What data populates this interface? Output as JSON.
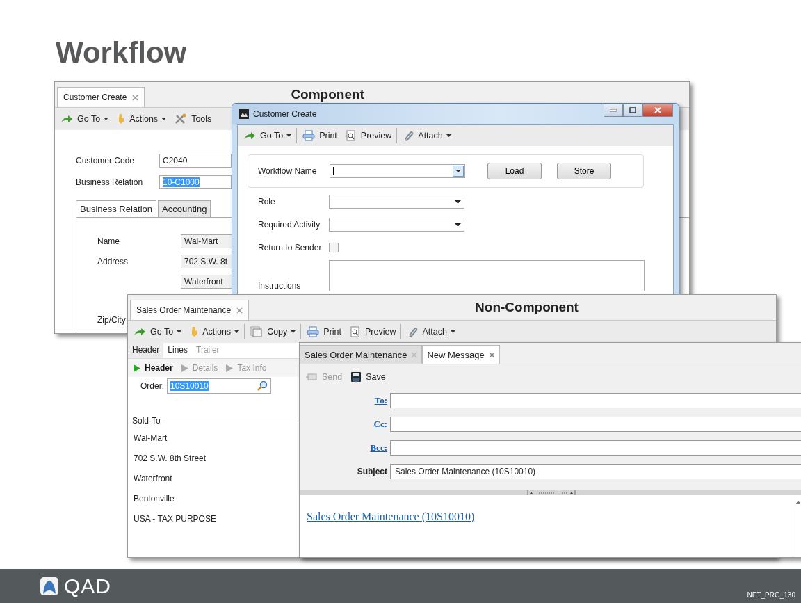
{
  "slide_title": "Workflow",
  "component_window": {
    "tabs": [
      {
        "label": "Customer Create",
        "selected": true
      }
    ],
    "caption": "Component",
    "toolbar": [
      {
        "kind": "goto",
        "label": "Go To",
        "dropdown": true,
        "separator_after": false,
        "disabled": false
      },
      {
        "kind": "actions",
        "label": "Actions",
        "dropdown": true,
        "separator_after": false,
        "disabled": false
      },
      {
        "kind": "tools",
        "label": "Tools",
        "dropdown": false,
        "separator_after": false,
        "disabled": false
      }
    ],
    "fields": [
      {
        "label": "Customer Code",
        "value": "C2040",
        "highlighted": false
      },
      {
        "label": "Business Relation",
        "value": "10-C1000",
        "highlighted": true
      }
    ],
    "section_tabs": [
      {
        "label": "Business Relation",
        "selected": true
      },
      {
        "label": "Accounting",
        "selected": false
      }
    ],
    "address_rows": [
      {
        "label": "Name",
        "value": "Wal-Mart"
      },
      {
        "label": "Address",
        "value": "702 S.W. 8t"
      },
      {
        "value": "Waterfront"
      }
    ],
    "zip_label": "Zip/City"
  },
  "dialog": {
    "title": "Customer Create",
    "toolbar": [
      {
        "kind": "goto",
        "label": "Go To",
        "dropdown": true,
        "separator_after": true,
        "disabled": false
      },
      {
        "kind": "print",
        "label": "Print",
        "dropdown": false,
        "separator_after": false,
        "disabled": false
      },
      {
        "kind": "preview",
        "label": "Preview",
        "dropdown": false,
        "separator_after": true,
        "disabled": false
      },
      {
        "kind": "attach",
        "label": "Attach",
        "dropdown": true,
        "separator_after": false,
        "disabled": false
      }
    ],
    "workflow_name_label": "Workflow Name",
    "buttons": [
      "Load",
      "Store"
    ],
    "dropdowns": [
      {
        "label": "Role"
      },
      {
        "label": "Required Activity"
      }
    ],
    "return_to_sender": {
      "label": "Return to Sender",
      "checked": false
    },
    "instructions_label": "Instructions"
  },
  "sales_window": {
    "tabs": [
      {
        "label": "Sales Order Maintenance",
        "selected": true
      }
    ],
    "caption": "Non-Component",
    "toolbar": [
      {
        "kind": "goto",
        "label": "Go To",
        "dropdown": true,
        "separator_after": false,
        "disabled": false
      },
      {
        "kind": "actions",
        "label": "Actions",
        "dropdown": true,
        "separator_after": true,
        "disabled": false
      },
      {
        "kind": "copy",
        "label": "Copy",
        "dropdown": true,
        "separator_after": true,
        "disabled": false
      },
      {
        "kind": "print",
        "label": "Print",
        "dropdown": false,
        "separator_after": false,
        "disabled": false
      },
      {
        "kind": "preview",
        "label": "Preview",
        "dropdown": false,
        "separator_after": true,
        "disabled": false
      },
      {
        "kind": "attach",
        "label": "Attach",
        "dropdown": true,
        "separator_after": false,
        "disabled": false
      }
    ],
    "section_tabs": [
      {
        "label": "Header",
        "selected": true,
        "disabled": false
      },
      {
        "label": "Lines",
        "selected": false,
        "disabled": false
      },
      {
        "label": "Trailer",
        "selected": false,
        "disabled": true
      }
    ],
    "steps": [
      {
        "label": "Header",
        "selected": true
      },
      {
        "label": "Details",
        "selected": false
      },
      {
        "label": "Tax Info",
        "selected": false
      }
    ],
    "order": {
      "label": "Order:",
      "value": "10S10010",
      "highlighted": true
    },
    "sold_to": {
      "heading": "Sold-To",
      "lines": [
        "Wal-Mart",
        "702 S.W. 8th Street",
        "Waterfront",
        "Bentonville",
        "USA - TAX PURPOSE"
      ]
    }
  },
  "message_window": {
    "tabs": [
      {
        "label": "Sales Order Maintenance",
        "selected": false
      },
      {
        "label": "New Message",
        "selected": true
      }
    ],
    "toolbar": [
      {
        "kind": "send",
        "label": "Send",
        "dropdown": false,
        "separator_after": false,
        "disabled": true
      },
      {
        "kind": "save",
        "label": "Save",
        "dropdown": false,
        "separator_after": false,
        "disabled": false
      }
    ],
    "fields": [
      {
        "kind": "link",
        "label": "To:"
      },
      {
        "kind": "link",
        "label": "Cc:"
      },
      {
        "kind": "link",
        "label": "Bcc:"
      },
      {
        "kind": "plain",
        "label": "Subject",
        "value": "Sales Order Maintenance (10S10010)"
      }
    ],
    "body_link": "Sales Order Maintenance (10S10010)"
  },
  "footer": {
    "logo": "QAD",
    "slide_code": "NET_PRG_130"
  }
}
